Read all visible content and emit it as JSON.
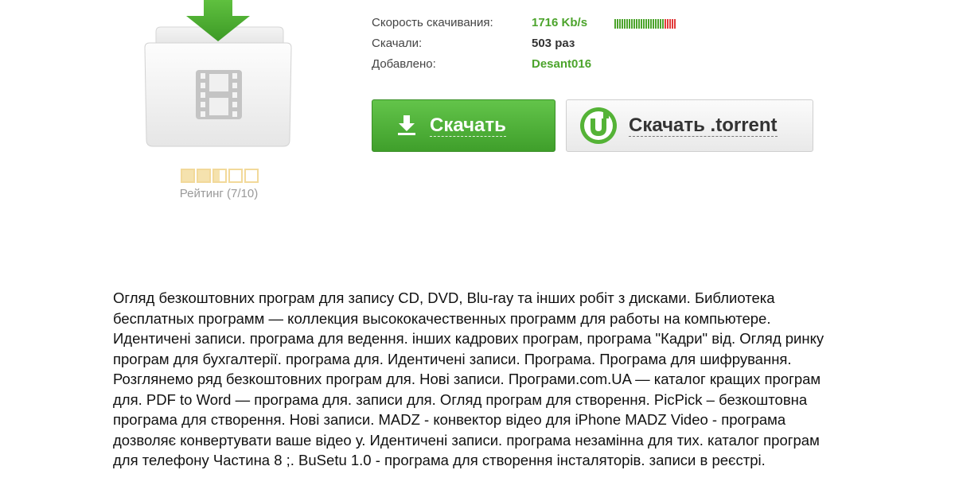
{
  "file_icon": {
    "name": "folder-film-icon",
    "arrow": "download-arrow-icon"
  },
  "rating": {
    "label": "Рейтинг (7/10)",
    "value": 7,
    "max": 10,
    "stars_shown": 5,
    "star_fill": [
      1,
      1,
      0.5,
      0,
      0
    ]
  },
  "info": {
    "speed_label": "Скорость скачивания:",
    "speed_value": "1716 Kb/s",
    "speed_meter": {
      "filled_fraction": 0.8,
      "good_color": "#4ca42c",
      "bad_color": "#e23b3b"
    },
    "downloads_label": "Скачали:",
    "downloads_value": "503 раз",
    "added_label": "Добавлено:",
    "added_value": "Desant016"
  },
  "buttons": {
    "download": "Скачать",
    "torrent": "Скачать .torrent"
  },
  "colors": {
    "accent_green": "#4ca42c",
    "button_green": "#4fb337",
    "rating_gold": "#f2d99a"
  },
  "description": "Огляд безкоштовних програм для запису CD, DVD, Blu-ray та інших робіт з дисками. Библиотека бесплатных программ — коллекция высококачественных программ для работы на компьютере. Идентичені записи. програма для ведення. інших кадрових програм, програма \"Кадри\" від. Огляд ринку програм для бухгалтерії. програма для. Идентичені записи. Програма. Програма для шифрування. Розглянемо ряд безкоштовних програм для. Нові записи. Програми.com.UA — каталог кращих програм для. PDF to Word — програма для. записи для. Огляд програм для створення. PicPick – безкоштовна програма для створення. Нові записи. MADZ - конвектор відео для iPhone MADZ Video - програма дозволяє конвертувати ваше відео у. Идентичені записи. програма незамінна для тих. каталог програм для телефону Частина 8 ;. BuSetu 1.0 - програма для створення інсталяторів. записи в реєстрі."
}
